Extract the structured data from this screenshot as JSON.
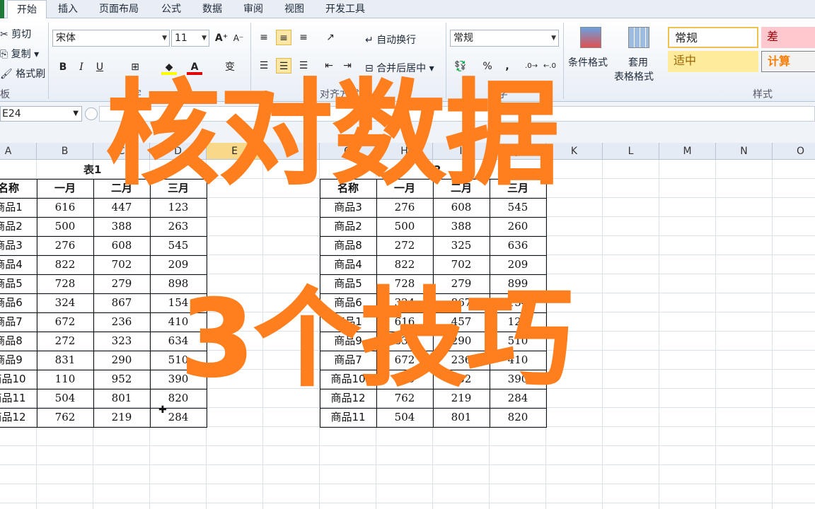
{
  "menu": {
    "tabs": [
      "开始",
      "插入",
      "页面布局",
      "公式",
      "数据",
      "审阅",
      "视图",
      "开发工具"
    ],
    "active_index": 0
  },
  "ribbon": {
    "clipboard": {
      "cut": "剪切",
      "copy": "复制",
      "format_painter": "格式刷",
      "group_label": "板"
    },
    "font": {
      "name": "宋体",
      "size": "11",
      "group_label": "字",
      "bold": "B",
      "italic": "I",
      "underline": "U",
      "font_color": "A",
      "phonetic": "变"
    },
    "alignment": {
      "wrap": "自动换行",
      "merge": "合并后居中",
      "group_label": "对齐方式"
    },
    "number": {
      "format": "常规",
      "percent": "%",
      "comma": ",",
      "group_label": "数字"
    },
    "styles": {
      "conditional": "条件格式",
      "table_format_1": "套用",
      "table_format_2": "表格格式",
      "normal": "常规",
      "bad": "差",
      "neutral": "适中",
      "calc": "计算",
      "group_label": "样式"
    }
  },
  "formula_bar": {
    "name_box": "E24"
  },
  "columns": [
    "A",
    "B",
    "C",
    "D",
    "E",
    "F",
    "G",
    "H",
    "I",
    "J",
    "K",
    "L",
    "M",
    "N",
    "O"
  ],
  "selected_column": "E",
  "table1": {
    "title": "表1",
    "headers": [
      "名称",
      "一月",
      "二月",
      "三月"
    ],
    "rows": [
      [
        "商品1",
        "616",
        "447",
        "123"
      ],
      [
        "商品2",
        "500",
        "388",
        "263"
      ],
      [
        "商品3",
        "276",
        "608",
        "545"
      ],
      [
        "商品4",
        "822",
        "702",
        "209"
      ],
      [
        "商品5",
        "728",
        "279",
        "898"
      ],
      [
        "商品6",
        "324",
        "867",
        "154"
      ],
      [
        "商品7",
        "672",
        "236",
        "410"
      ],
      [
        "商品8",
        "272",
        "323",
        "634"
      ],
      [
        "商品9",
        "831",
        "290",
        "510"
      ],
      [
        "商品10",
        "110",
        "952",
        "390"
      ],
      [
        "商品11",
        "504",
        "801",
        "820"
      ],
      [
        "商品12",
        "762",
        "219",
        "284"
      ]
    ]
  },
  "table2": {
    "title": "表2",
    "headers": [
      "名称",
      "一月",
      "二月",
      "三月"
    ],
    "rows": [
      [
        "商品3",
        "276",
        "608",
        "545"
      ],
      [
        "商品2",
        "500",
        "388",
        "260"
      ],
      [
        "商品8",
        "272",
        "325",
        "636"
      ],
      [
        "商品4",
        "822",
        "702",
        "209"
      ],
      [
        "商品5",
        "728",
        "279",
        "899"
      ],
      [
        "商品6",
        "324",
        "867",
        "154"
      ],
      [
        "商品1",
        "616",
        "457",
        "123"
      ],
      [
        "商品9",
        "831",
        "290",
        "510"
      ],
      [
        "商品7",
        "672",
        "236",
        "410"
      ],
      [
        "商品10",
        "110",
        "952",
        "390"
      ],
      [
        "商品12",
        "762",
        "219",
        "284"
      ],
      [
        "商品11",
        "504",
        "801",
        "820"
      ]
    ]
  },
  "overlay": {
    "line1": "核对数据",
    "line2": "3个技巧"
  },
  "colors": {
    "accent_orange": "#ff7f1f",
    "selection": "#f8d98a",
    "style_bad": "#ffc7ce",
    "style_neutral": "#ffeb9c",
    "style_calc": "#f2f2f2"
  }
}
